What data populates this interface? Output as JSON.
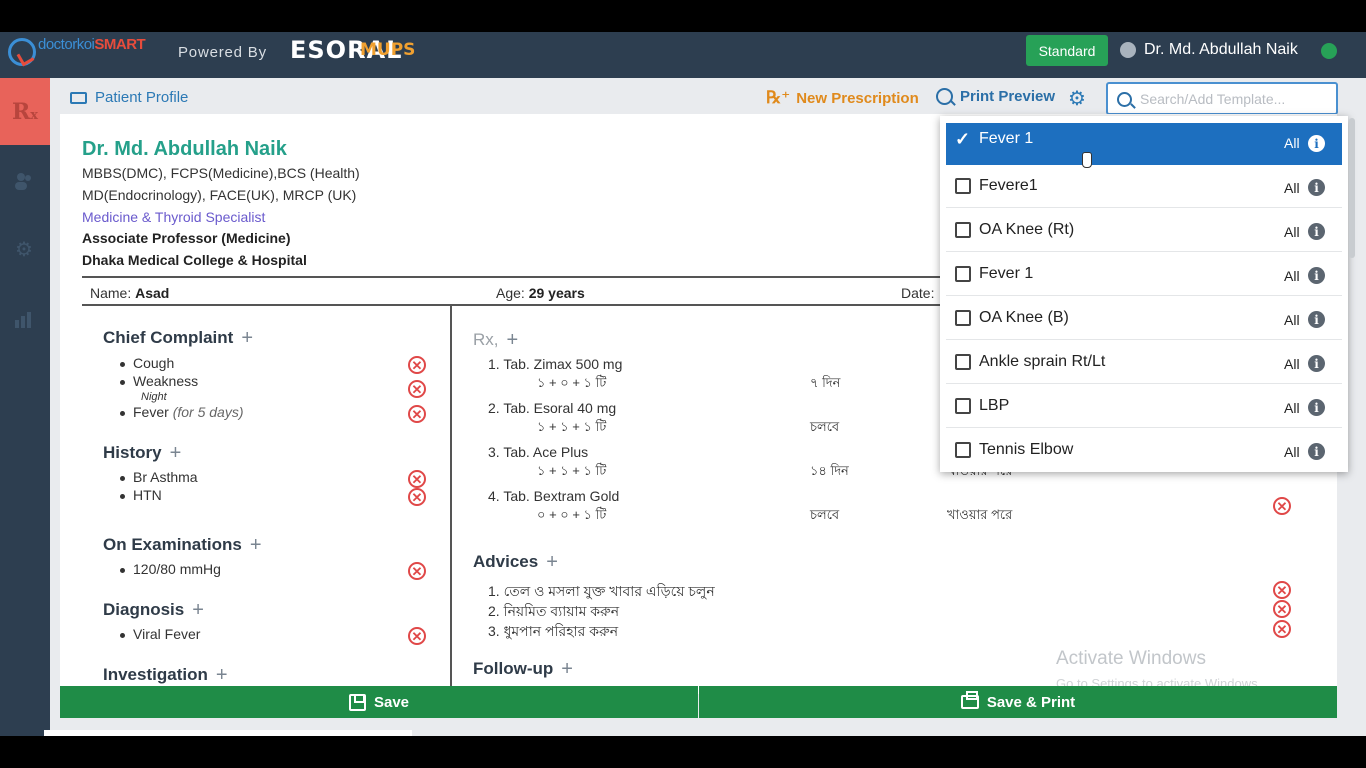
{
  "topbar": {
    "logo_primary": "doctorkoi",
    "logo_accent": "SMART",
    "powered_by": "Powered By",
    "brand": "ESORAL",
    "brand_suffix": "MUPS",
    "plan_button": "Standard",
    "user_name": "Dr. Md. Abdullah Naik"
  },
  "toolbar": {
    "patient_profile": "Patient Profile",
    "new_prescription": "New Prescription",
    "print_preview": "Print Preview",
    "search_placeholder": "Search/Add Template..."
  },
  "doctor": {
    "name": "Dr. Md. Abdullah Naik",
    "degrees_1": "MBBS(DMC), FCPS(Medicine),BCS (Health)",
    "degrees_2": "MD(Endocrinology), FACE(UK), MRCP (UK)",
    "specialty": "Medicine & Thyroid Specialist",
    "position": "Associate Professor (Medicine)",
    "hospital": "Dhaka Medical College & Hospital"
  },
  "patient": {
    "name_label": "Name:",
    "name": "Asad",
    "age_label": "Age:",
    "age": "29 years",
    "date_label": "Date:"
  },
  "sections": {
    "chief_complaint": {
      "title": "Chief Complaint",
      "items": [
        "Cough",
        "Weakness",
        "Fever"
      ],
      "weakness_note": "Night",
      "fever_note": "(for 5 days)"
    },
    "history": {
      "title": "History",
      "items": [
        "Br Asthma",
        "HTN"
      ]
    },
    "examinations": {
      "title": "On Examinations",
      "items": [
        "120/80 mmHg"
      ]
    },
    "diagnosis": {
      "title": "Diagnosis",
      "items": [
        "Viral Fever"
      ]
    },
    "investigation": {
      "title": "Investigation"
    }
  },
  "rx": {
    "label": "Rx,",
    "medicines": [
      {
        "name": "1. Tab. Zimax 500 mg",
        "dose": "১ + ০ + ১ টি",
        "duration": "৭ দিন",
        "instruction": ""
      },
      {
        "name": "2. Tab. Esoral 40 mg",
        "dose": "১ + ১ + ১ টি",
        "duration": "চলবে",
        "instruction": ""
      },
      {
        "name": "3. Tab. Ace Plus",
        "dose": "১ + ১ + ১ টি",
        "duration": "১৪ দিন",
        "instruction": "খাওয়ার পরে"
      },
      {
        "name": "4. Tab. Bextram Gold",
        "dose": "০ + ০ + ১ টি",
        "duration": "চলবে",
        "instruction": "খাওয়ার পরে"
      }
    ]
  },
  "advices": {
    "title": "Advices",
    "items": [
      "1. তেল ও মসলা যুক্ত খাবার এড়িয়ে চলুন",
      "2. নিয়মিত ব্যায়াম করুন",
      "3. ধুমপান পরিহার করুন"
    ]
  },
  "followup": {
    "title": "Follow-up"
  },
  "buttons": {
    "save": "Save",
    "save_print": "Save & Print"
  },
  "dropdown": {
    "scope_label": "All",
    "items": [
      {
        "label": "Fever 1",
        "selected": true
      },
      {
        "label": "Fevere1",
        "selected": false
      },
      {
        "label": "OA Knee (Rt)",
        "selected": false
      },
      {
        "label": "Fever 1",
        "selected": false
      },
      {
        "label": "OA Knee (B)",
        "selected": false
      },
      {
        "label": "Ankle sprain Rt/Lt",
        "selected": false
      },
      {
        "label": "LBP",
        "selected": false
      },
      {
        "label": "Tennis Elbow",
        "selected": false
      }
    ]
  },
  "watermark": {
    "title": "Activate Windows",
    "subtitle": "Go to Settings to activate Windows."
  },
  "colors": {
    "accent": "#2d3e50",
    "brand_green": "#1f8c47",
    "selected_blue": "#1d6fbf",
    "delete_red": "#e04848",
    "doctor_teal": "#25a08a"
  }
}
